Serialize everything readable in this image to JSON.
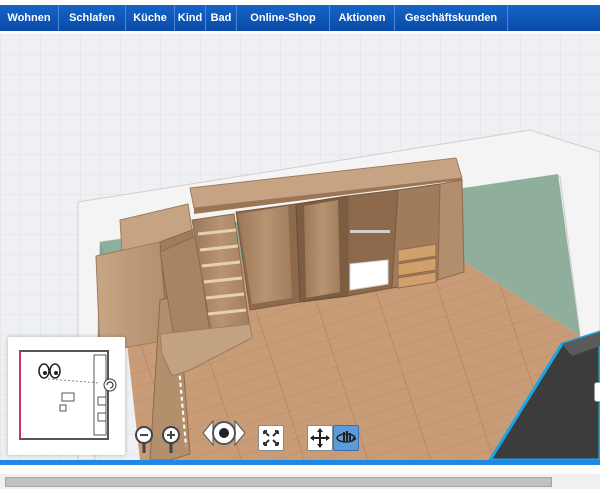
{
  "nav": {
    "items": [
      {
        "label": "Wohnen"
      },
      {
        "label": "Schlafen"
      },
      {
        "label": "Küche"
      },
      {
        "label": "Kind"
      },
      {
        "label": "Bad"
      },
      {
        "label": "Online-Shop"
      },
      {
        "label": "Aktionen"
      },
      {
        "label": "Geschäftskunden"
      }
    ]
  },
  "colors": {
    "nav_background": "#0a4aa6",
    "wall": "#8fae9b",
    "wood": "#b08a64",
    "floor": "#c99c78",
    "selection_outline": "#19a6e8"
  },
  "controls": {
    "zoom_out_icon": "magnifier-minus",
    "zoom_in_icon": "magnifier-plus",
    "rotate_icon": "rotate-arrows",
    "fit_icon": "fit-screen",
    "move_icon": "move-arrows",
    "orbit_icon": "orbit-hand"
  }
}
